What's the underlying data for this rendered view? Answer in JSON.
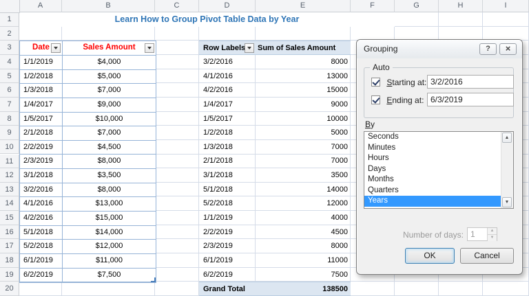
{
  "sheet": {
    "title": "Learn How to Group Pivot Table Data by Year",
    "columns": [
      "A",
      "B",
      "C",
      "D",
      "E",
      "F",
      "G",
      "H",
      "I"
    ],
    "row_count": 20
  },
  "data_table": {
    "headers": [
      "Date",
      "Sales Amount"
    ],
    "rows": [
      [
        "1/1/2019",
        "$4,000"
      ],
      [
        "1/2/2018",
        "$5,000"
      ],
      [
        "1/3/2018",
        "$7,000"
      ],
      [
        "1/4/2017",
        "$9,000"
      ],
      [
        "1/5/2017",
        "$10,000"
      ],
      [
        "2/1/2018",
        "$7,000"
      ],
      [
        "2/2/2019",
        "$4,500"
      ],
      [
        "2/3/2019",
        "$8,000"
      ],
      [
        "3/1/2018",
        "$3,500"
      ],
      [
        "3/2/2016",
        "$8,000"
      ],
      [
        "4/1/2016",
        "$13,000"
      ],
      [
        "4/2/2016",
        "$15,000"
      ],
      [
        "5/1/2018",
        "$14,000"
      ],
      [
        "5/2/2018",
        "$12,000"
      ],
      [
        "6/1/2019",
        "$11,000"
      ],
      [
        "6/2/2019",
        "$7,500"
      ]
    ]
  },
  "pivot_table": {
    "headers": [
      "Row Labels",
      "Sum of Sales Amount"
    ],
    "rows": [
      [
        "3/2/2016",
        "8000"
      ],
      [
        "4/1/2016",
        "13000"
      ],
      [
        "4/2/2016",
        "15000"
      ],
      [
        "1/4/2017",
        "9000"
      ],
      [
        "1/5/2017",
        "10000"
      ],
      [
        "1/2/2018",
        "5000"
      ],
      [
        "1/3/2018",
        "7000"
      ],
      [
        "2/1/2018",
        "7000"
      ],
      [
        "3/1/2018",
        "3500"
      ],
      [
        "5/1/2018",
        "14000"
      ],
      [
        "5/2/2018",
        "12000"
      ],
      [
        "1/1/2019",
        "4000"
      ],
      [
        "2/2/2019",
        "4500"
      ],
      [
        "2/3/2019",
        "8000"
      ],
      [
        "6/1/2019",
        "11000"
      ],
      [
        "6/2/2019",
        "7500"
      ]
    ],
    "grand_total": {
      "label": "Grand Total",
      "value": "138500"
    }
  },
  "dialog": {
    "title": "Grouping",
    "help_glyph": "?",
    "close_glyph": "×",
    "auto_label": "Auto",
    "starting": {
      "label": "Starting at:",
      "value": "3/2/2016",
      "checked": true
    },
    "ending": {
      "label": "Ending at:",
      "value": "6/3/2019",
      "checked": true
    },
    "by_label": "By",
    "by_options": [
      "Seconds",
      "Minutes",
      "Hours",
      "Days",
      "Months",
      "Quarters",
      "Years"
    ],
    "by_selected": "Years",
    "number_of_days": {
      "label": "Number of days:",
      "value": "1"
    },
    "ok_label": "OK",
    "cancel_label": "Cancel"
  },
  "icons": {
    "scroll_up": "▲",
    "scroll_down": "▼",
    "spinner_up": "▲",
    "spinner_down": "▼"
  },
  "colors": {
    "title_text": "#2E75B6",
    "table_header_text": "#FF0000",
    "table_border": "#95B3D7",
    "pivot_fill": "#DCE6F1",
    "selection": "#3399FF"
  }
}
